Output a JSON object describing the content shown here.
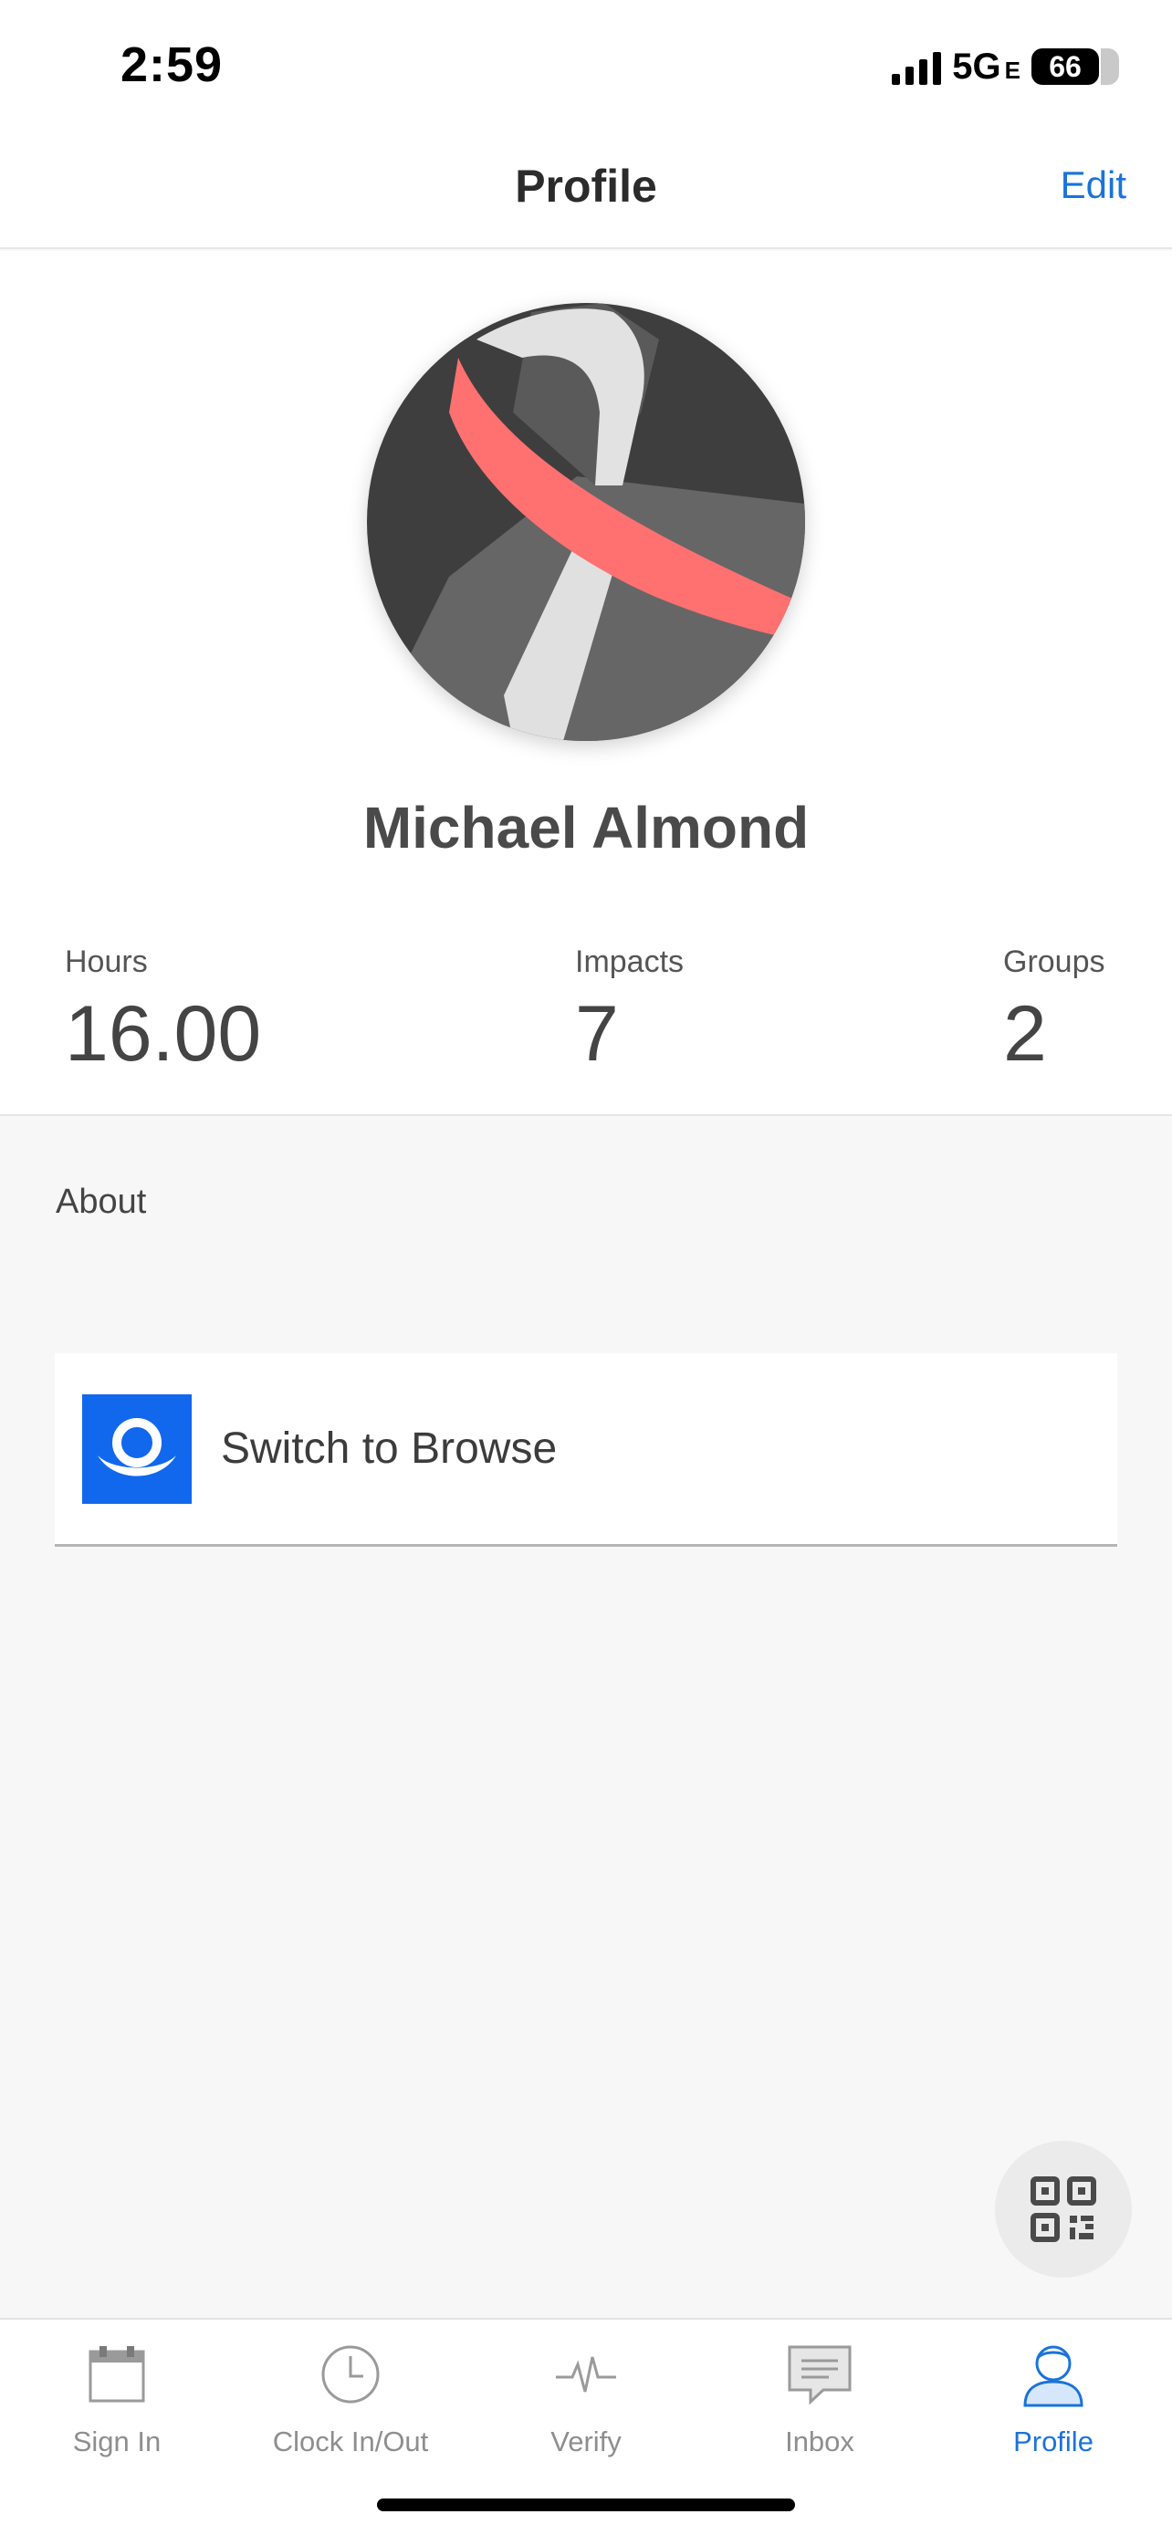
{
  "status_bar": {
    "time": "2:59",
    "network": "5G",
    "network_suffix": "E",
    "battery": "66"
  },
  "header": {
    "title": "Profile",
    "edit_label": "Edit"
  },
  "profile": {
    "name": "Michael Almond",
    "avatar_icon": "awareness-ribbon-avatar"
  },
  "stats": [
    {
      "label": "Hours",
      "value": "16.00"
    },
    {
      "label": "Impacts",
      "value": "7"
    },
    {
      "label": "Groups",
      "value": "2"
    }
  ],
  "about": {
    "label": "About"
  },
  "switch_browse": {
    "label": "Switch to Browse",
    "icon": "browse-logo-icon"
  },
  "tabs": [
    {
      "label": "Sign In",
      "icon": "calendar-icon",
      "active": false
    },
    {
      "label": "Clock In/Out",
      "icon": "clock-icon",
      "active": false
    },
    {
      "label": "Verify",
      "icon": "pulse-icon",
      "active": false
    },
    {
      "label": "Inbox",
      "icon": "message-icon",
      "active": false
    },
    {
      "label": "Profile",
      "icon": "person-icon",
      "active": true
    }
  ],
  "colors": {
    "accent": "#1a73d9",
    "brand_blue": "#1168ec",
    "ribbon_red": "#ff7070",
    "background": "#f7f7f7"
  }
}
